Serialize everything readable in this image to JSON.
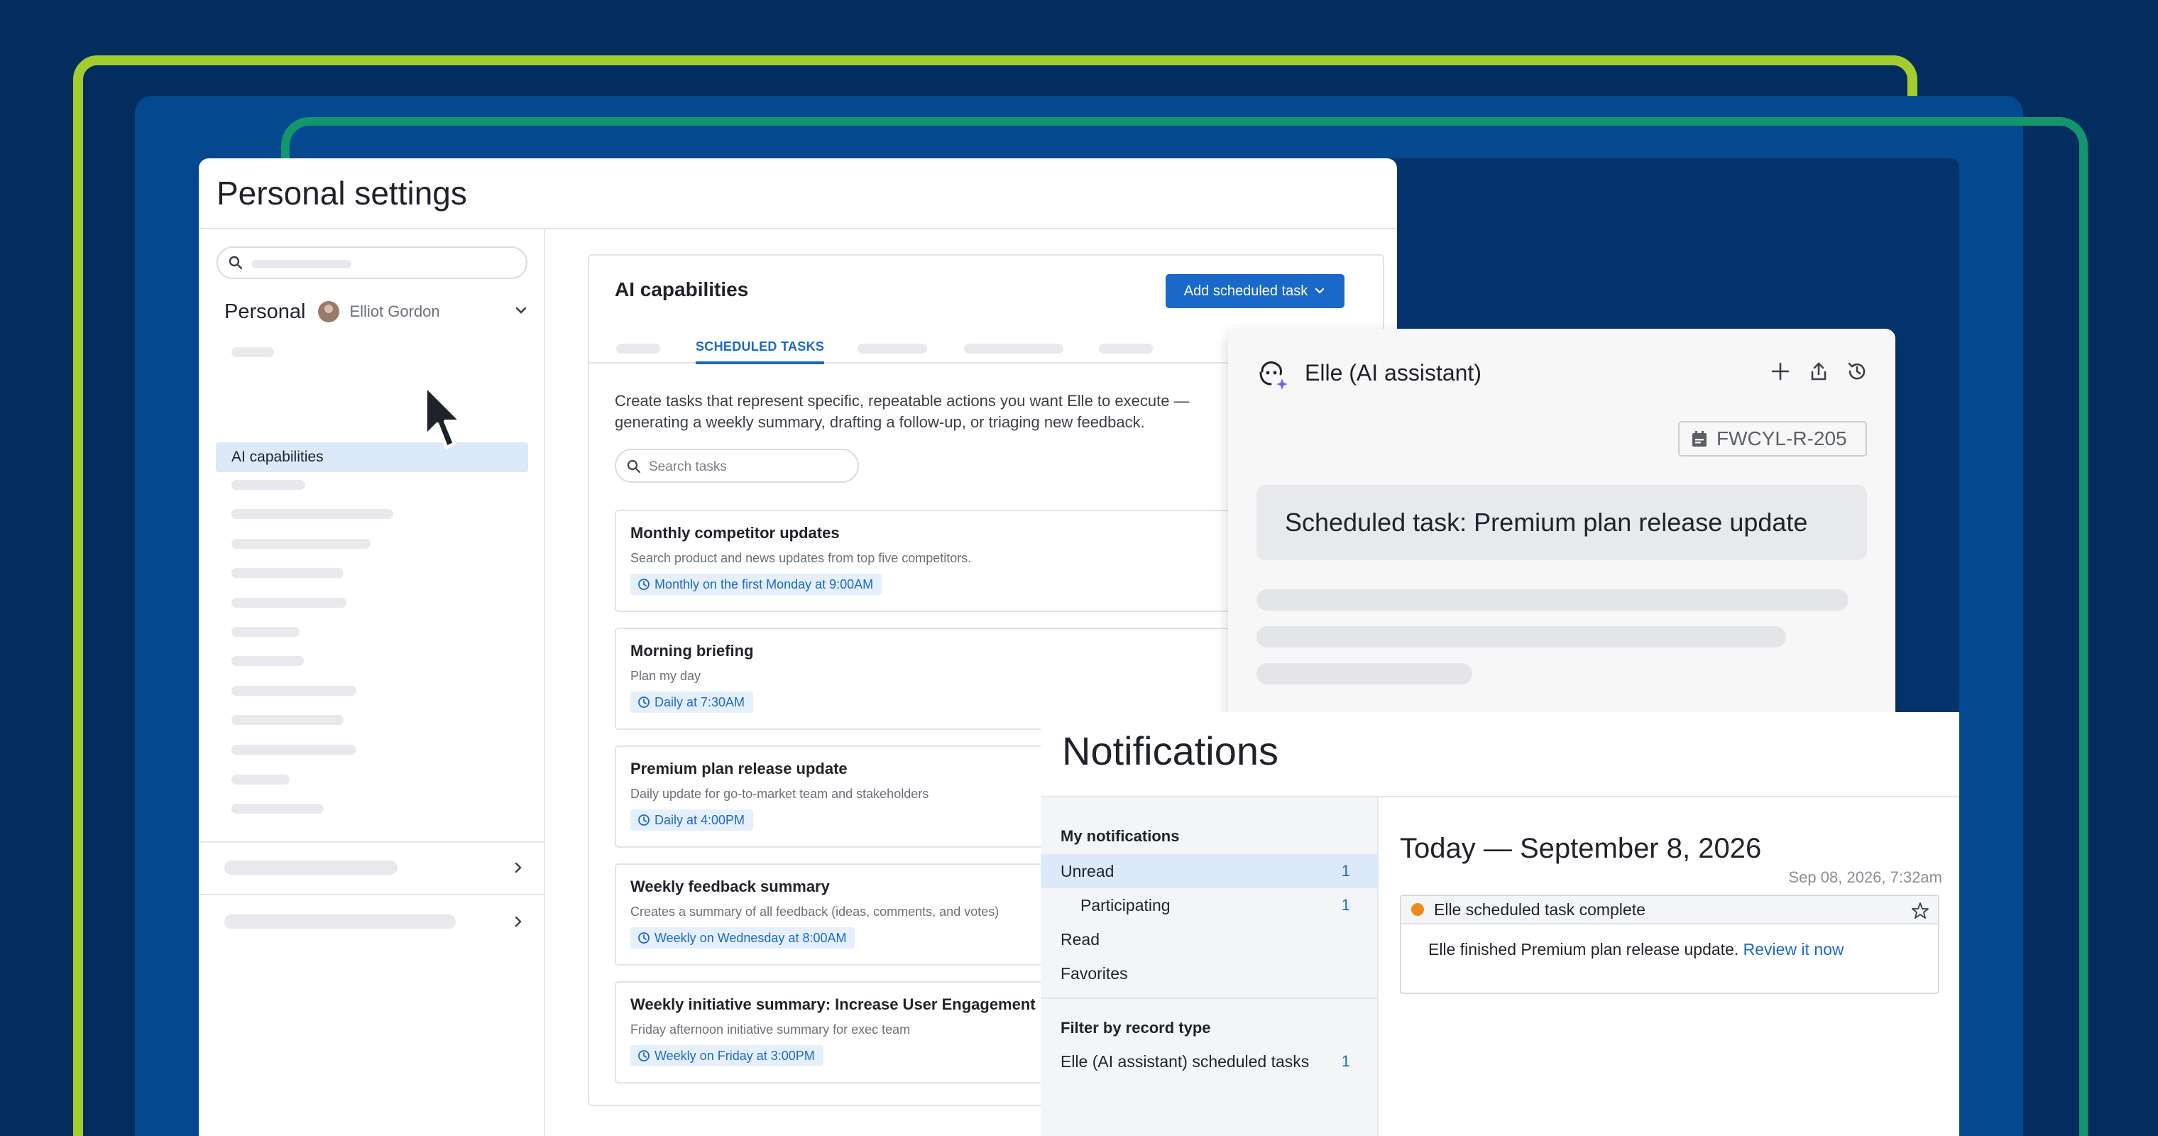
{
  "settings": {
    "title": "Personal settings",
    "section": "Personal",
    "user_name": "Elliot Gordon",
    "active_item": "AI capabilities"
  },
  "ai_card": {
    "title": "AI capabilities",
    "add_button": "Add scheduled task",
    "active_tab": "SCHEDULED TASKS",
    "description": "Create tasks that represent specific, repeatable actions you want Elle to execute — generating a weekly summary, drafting a follow-up, or triaging new feedback.",
    "search_placeholder": "Search tasks",
    "tasks": [
      {
        "title": "Monthly competitor updates",
        "subtitle": "Search product and news updates from top five competitors.",
        "schedule": "Monthly on the first Monday at 9:00AM"
      },
      {
        "title": "Morning briefing",
        "subtitle": "Plan my day",
        "schedule": "Daily at 7:30AM"
      },
      {
        "title": "Premium plan release update",
        "subtitle": "Daily update for go-to-market team and stakeholders",
        "schedule": "Daily at 4:00PM"
      },
      {
        "title": "Weekly feedback summary",
        "subtitle": "Creates a summary of all feedback (ideas, comments, and votes)",
        "schedule": "Weekly on Wednesday at 8:00AM"
      },
      {
        "title": "Weekly initiative summary: Increase User Engagement",
        "subtitle": "Friday afternoon initiative summary for exec team",
        "schedule": "Weekly on Friday at 3:00PM"
      }
    ]
  },
  "elle": {
    "title": "Elle (AI assistant)",
    "ticket": "FWCYL-R-205",
    "message": "Scheduled task: Premium plan release update"
  },
  "notifications": {
    "title": "Notifications",
    "my_heading": "My notifications",
    "items": [
      {
        "label": "Unread",
        "count": "1"
      },
      {
        "label": "Participating",
        "count": "1"
      },
      {
        "label": "Read",
        "count": ""
      },
      {
        "label": "Favorites",
        "count": ""
      }
    ],
    "filter_heading": "Filter by record type",
    "filter_item": {
      "label": "Elle (AI assistant) scheduled tasks",
      "count": "1"
    },
    "date_heading": "Today — September 8, 2026",
    "timestamp": "Sep 08, 2026, 7:32am",
    "card_title": "Elle scheduled task complete",
    "card_body": "Elle finished Premium plan release update.",
    "card_link": "Review it now"
  },
  "colors": {
    "background": "#032d5e",
    "accent_lime": "#a3cd2e",
    "accent_green": "#14966d",
    "primary": "#1a68c9",
    "unread_dot": "#f08a1b"
  }
}
